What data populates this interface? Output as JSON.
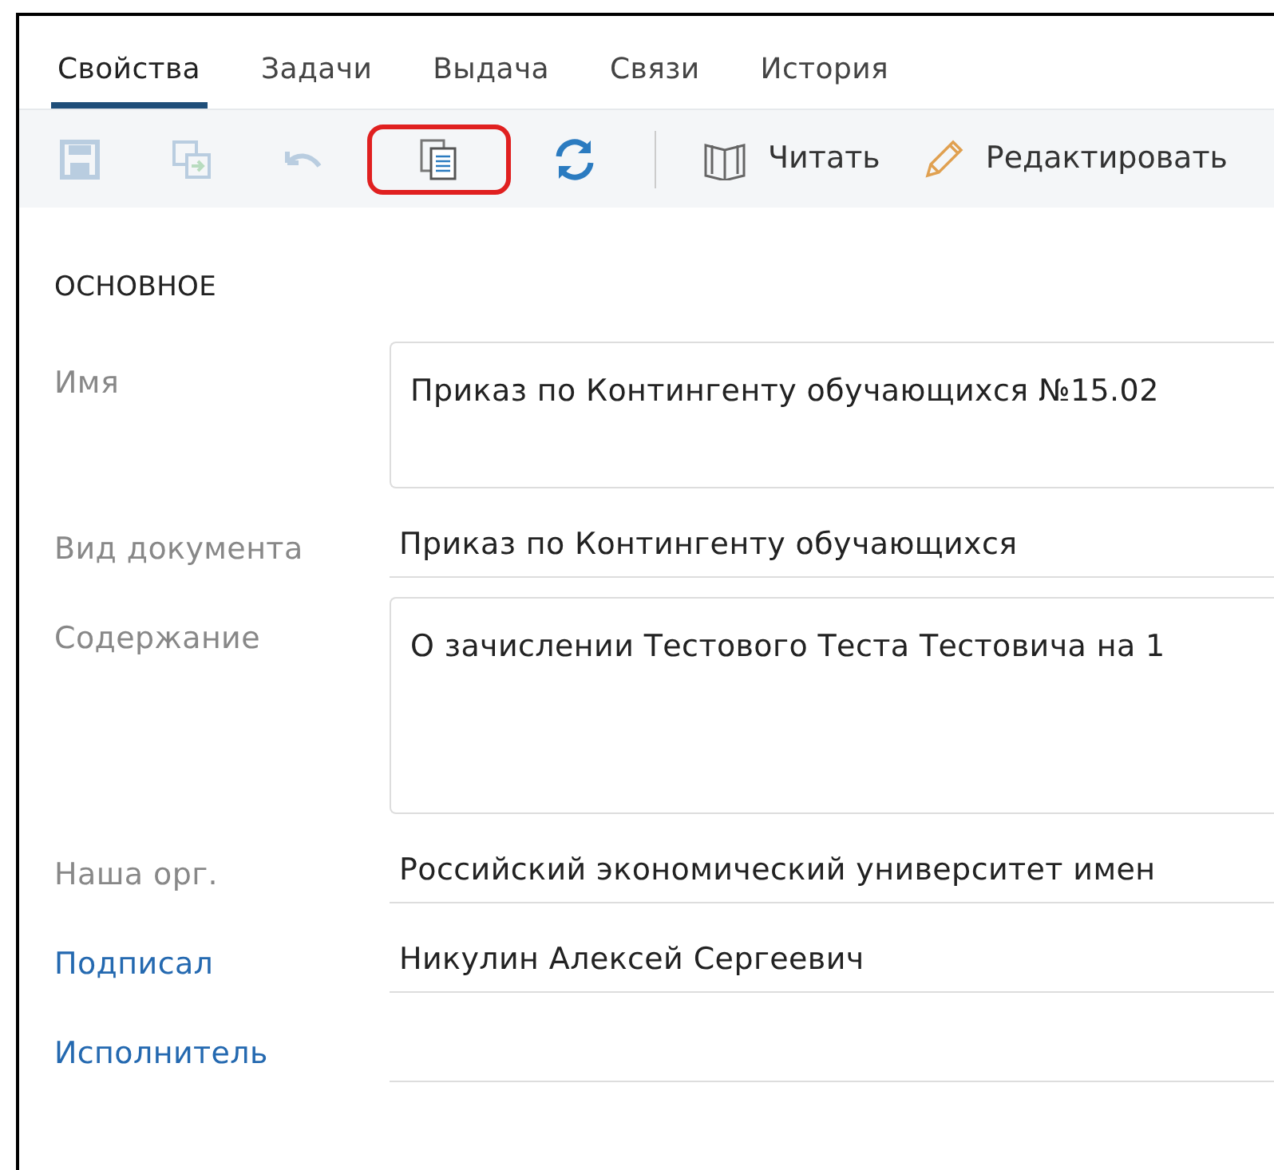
{
  "tabs": [
    {
      "label": "Свойства",
      "selected": true
    },
    {
      "label": "Задачи",
      "selected": false
    },
    {
      "label": "Выдача",
      "selected": false
    },
    {
      "label": "Связи",
      "selected": false
    },
    {
      "label": "История",
      "selected": false
    }
  ],
  "toolbar": [
    {
      "kind": "save",
      "disabled": true,
      "highlighted": false
    },
    {
      "kind": "save-as",
      "disabled": true,
      "highlighted": false
    },
    {
      "kind": "undo",
      "disabled": true,
      "highlighted": false
    },
    {
      "kind": "copy",
      "disabled": false,
      "highlighted": true
    },
    {
      "kind": "refresh",
      "disabled": false,
      "highlighted": false
    },
    {
      "kind": "separator"
    },
    {
      "kind": "read",
      "label": "Читать",
      "disabled": false,
      "highlighted": false
    },
    {
      "kind": "edit",
      "label": "Редактировать",
      "disabled": false,
      "highlighted": false
    }
  ],
  "section": {
    "title": "ОСНОВНОЕ"
  },
  "fields": [
    {
      "label": "Имя",
      "kind": "textarea",
      "link": false,
      "value": "Приказ по Контингенту обучающихся №15.02"
    },
    {
      "label": "Вид документа",
      "kind": "line",
      "link": false,
      "value": "Приказ по Контингенту обучающихся"
    },
    {
      "label": "Содержание",
      "kind": "memo",
      "link": false,
      "value": "О зачислении Тестового Теста Тестовича на 1"
    },
    {
      "label": "Наша орг.",
      "kind": "line",
      "link": false,
      "value": "Российский экономический университет имен"
    },
    {
      "label": "Подписал",
      "kind": "line",
      "link": true,
      "value": "Никулин Алексей Сергеевич"
    },
    {
      "label": "Исполнитель",
      "kind": "line",
      "link": true
    }
  ]
}
